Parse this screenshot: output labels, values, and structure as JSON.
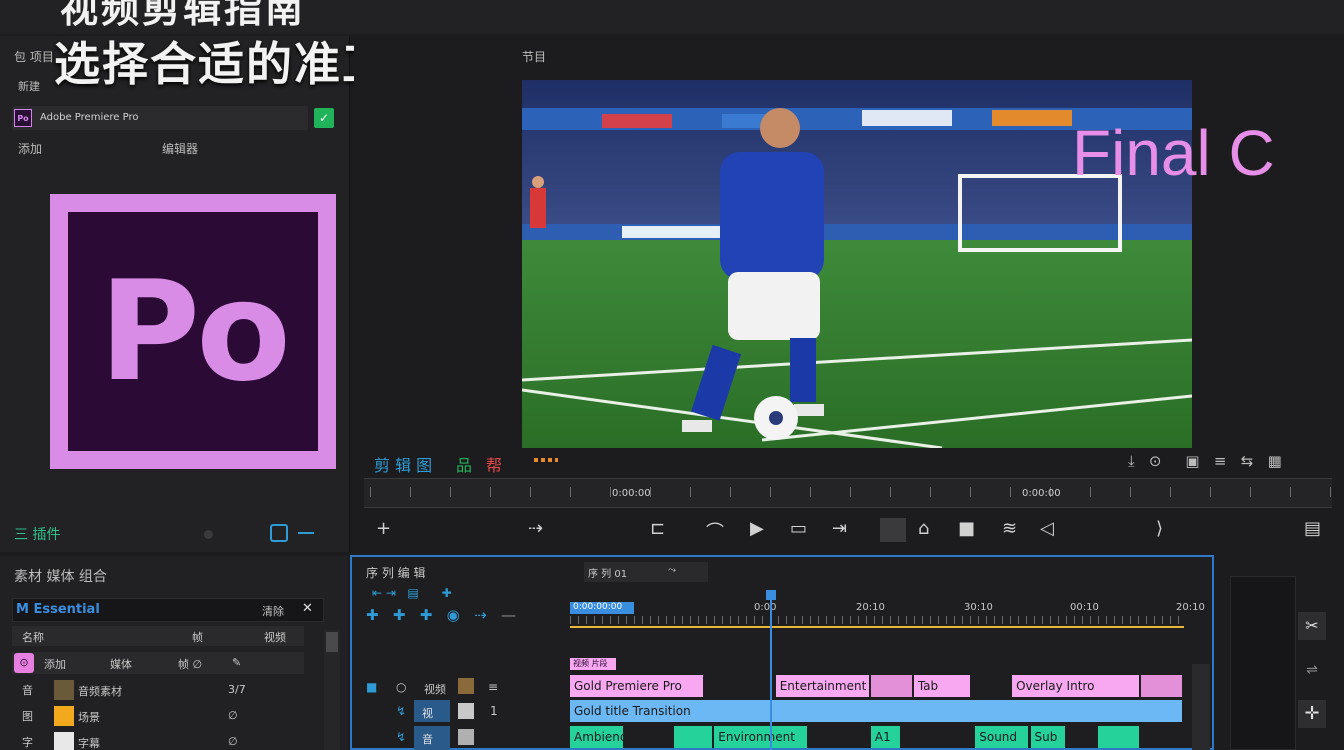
{
  "overlay": {
    "title_top": "视频剪辑指南",
    "title_main": "选择合适的准工件"
  },
  "left_panel": {
    "header_label": "包 项目",
    "sub_label": "新建",
    "app_row_icon_text": "Po",
    "app_row_name": "Adobe Premiere Pro",
    "app_row_badge": "✓",
    "field_a": "添加",
    "field_b": "编辑器",
    "logo_text": "Po",
    "bottom_label": "三 插件"
  },
  "monitor": {
    "tab_label": "节目",
    "overlay_text": "Final C",
    "timecode_left": "0:00:00",
    "timecode_right": "0:00:00",
    "ctrl_labels": [
      "剪 辑 图",
      "品",
      "帮"
    ],
    "transport_icons": [
      "+",
      "⇢",
      "⊏",
      "⌒",
      "▶",
      "▭",
      "⇥",
      "■",
      "⌂",
      "■",
      "≋",
      "◁",
      "⟩",
      "▤"
    ]
  },
  "project_panel": {
    "title": "素材 媒体 组合",
    "search_value": "M Essential",
    "search_right": "清除",
    "header_cols": [
      "名称",
      "帧",
      "视频"
    ],
    "filter_chip": "添加",
    "filter_items": [
      "媒体",
      "帧 ∅",
      "✎"
    ],
    "rows": [
      {
        "icon": "音",
        "name": "音频素材",
        "rate": "3/7",
        "thumb_color": "#6a5a3a"
      },
      {
        "icon": "图",
        "name": "场景",
        "rate": "∅",
        "thumb_color": "#f2a91e"
      },
      {
        "icon": "字",
        "name": "字幕",
        "rate": "∅",
        "thumb_color": "#e8e8e8"
      }
    ]
  },
  "timeline": {
    "title": "序 列 编 辑",
    "tab_label": "序 列 01",
    "tab_icon": "⤳",
    "ruler_labels": [
      "0:00:00:00",
      "0:00",
      "20:10",
      "30:10",
      "00:10",
      "20:10"
    ],
    "section_tag": "视频 片段",
    "tracks": [
      {
        "ctrl": [
          "■",
          "○",
          "视频",
          "▣",
          "≡"
        ],
        "clips": [
          {
            "label": "Gold Premiere Pro",
            "color": "#f8a8f0",
            "start": 0,
            "end": 0.22
          },
          {
            "label": "Entertainment",
            "color": "#f8a8f0",
            "start": 0.335,
            "end": 0.49
          },
          {
            "label": "",
            "color": "#e390d8",
            "start": 0.49,
            "end": 0.56
          },
          {
            "label": "Tab",
            "color": "#f8a8f0",
            "start": 0.56,
            "end": 0.655
          },
          {
            "label": "Overlay Intro",
            "color": "#f8a8f0",
            "start": 0.72,
            "end": 0.93
          },
          {
            "label": "",
            "color": "#e390d8",
            "start": 0.93,
            "end": 1.0
          }
        ]
      },
      {
        "ctrl": [
          "↯",
          "视",
          "▣",
          "1"
        ],
        "clips": [
          {
            "label": "Gold title  Transition",
            "color": "#6bb8f4",
            "start": 0,
            "end": 1.0
          }
        ]
      },
      {
        "ctrl": [
          "↯",
          "音",
          "▣",
          "≡"
        ],
        "clips": [
          {
            "label": "Ambience",
            "color": "#25d39a",
            "start": 0,
            "end": 0.09
          },
          {
            "label": "",
            "color": "#25d39a",
            "start": 0.17,
            "end": 0.235
          },
          {
            "label": "Environment",
            "color": "#25d39a",
            "start": 0.235,
            "end": 0.39
          },
          {
            "label": "A1",
            "color": "#25d39a",
            "start": 0.49,
            "end": 0.54
          },
          {
            "label": "Sound",
            "color": "#25d39a",
            "start": 0.66,
            "end": 0.75
          },
          {
            "label": "Sub",
            "color": "#25d39a",
            "start": 0.75,
            "end": 0.81
          },
          {
            "label": "",
            "color": "#25d39a",
            "start": 0.86,
            "end": 0.93
          }
        ]
      }
    ],
    "left_icons": [
      "✚",
      "✚",
      "✚",
      "◉",
      "⇢",
      "—"
    ]
  },
  "colors": {
    "accent_blue": "#2d79c7",
    "premiere_pink": "#d88ce6",
    "premiere_dark": "#2b0a36",
    "green": "#21b35a",
    "yellow_line": "#e9b53a"
  }
}
